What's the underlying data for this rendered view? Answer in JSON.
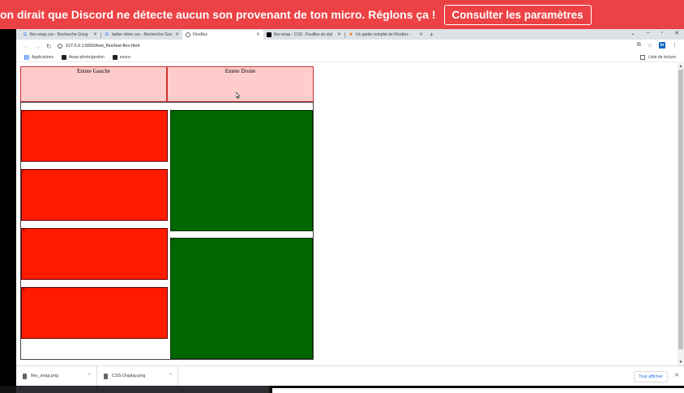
{
  "banner": {
    "text": "on dirait que Discord ne détecte aucun son provenant de ton micro. Réglons ça !",
    "button": "Consulter les paramètres"
  },
  "tabs": [
    {
      "title": "flex-wrap css - Recherche Goog",
      "active": false
    },
    {
      "title": "balise inline css - Recherche Goo",
      "active": false
    },
    {
      "title": "FlexBox",
      "active": true
    },
    {
      "title": "flex-wrap - CSS : Feuilles de styl",
      "active": false
    },
    {
      "title": "Un guide complet de Flexbox - ",
      "active": false
    }
  ],
  "url": "127.0.0.1:5500/test_flex/test-flex.html",
  "bookmarks": [
    "Applications",
    "Away-photo/gestion",
    "anunc"
  ],
  "reading_list": "Liste de lecture",
  "page": {
    "header_left": "Entete Gauche",
    "header_right": "Entete Droite",
    "red_boxes": [
      "1",
      "2",
      "3",
      "4"
    ],
    "green_boxes": [
      "5",
      "6"
    ]
  },
  "downloads": {
    "items": [
      "flex_wrap.png",
      "CSS-Display.png"
    ],
    "show_all": "Tout afficher"
  },
  "colors": {
    "banner": "#ed4245",
    "header_bg": "#ffcccc",
    "red_box": "#ff1a00",
    "green_box": "#006600"
  }
}
